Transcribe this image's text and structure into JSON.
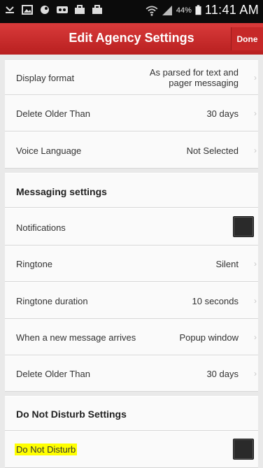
{
  "header": {
    "title": "Edit Agency Settings",
    "done_label": "Done"
  },
  "status_bar": {
    "battery_percent": "44%",
    "time": "11:41 AM",
    "left_icons": [
      "missed-call-icon",
      "gallery-icon",
      "app-icon",
      "voicemail-icon",
      "briefcase-icon",
      "briefcase-icon"
    ],
    "right_icons": [
      "wifi-icon",
      "signal-icon",
      "battery-icon"
    ]
  },
  "rows": {
    "display_format": {
      "label": "Display format",
      "value_line1": "As parsed for text and",
      "value_line2": "pager messaging"
    },
    "delete_older_than_1": {
      "label": "Delete Older Than",
      "value": "30 days"
    },
    "voice_language": {
      "label": "Voice Language",
      "value": "Not Selected"
    },
    "messaging_settings": {
      "label": "Messaging settings"
    },
    "notifications": {
      "label": "Notifications",
      "checked": false
    },
    "ringtone": {
      "label": "Ringtone",
      "value": "Silent"
    },
    "ringtone_duration": {
      "label": "Ringtone duration",
      "value": "10 seconds"
    },
    "new_message": {
      "label": "When a new message arrives",
      "value": "Popup window"
    },
    "delete_older_than_2": {
      "label": "Delete Older Than",
      "value": "30 days"
    },
    "dnd_settings": {
      "label": "Do Not Disturb Settings"
    },
    "do_not_disturb": {
      "label": "Do Not Disturb",
      "checked": false,
      "highlight_color": "#ffff00"
    }
  },
  "colors": {
    "header_red": "#c62828",
    "status_bar": "#0b0b0b",
    "background": "#e9e9e9"
  },
  "chevron": "›"
}
